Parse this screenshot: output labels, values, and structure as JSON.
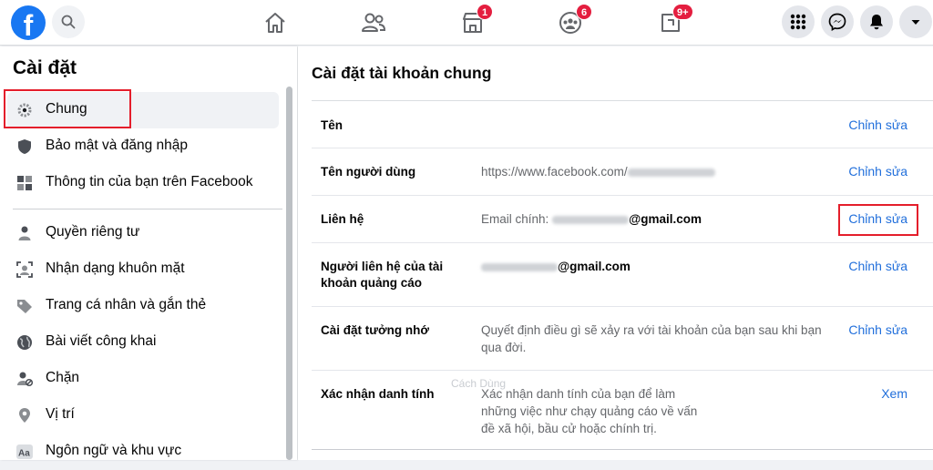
{
  "topbar": {
    "logo_letter": "f",
    "badges": {
      "marketplace": "1",
      "groups": "6",
      "gaming": "9+"
    },
    "icons": {
      "search": "search-icon",
      "home": "home-icon",
      "friends": "friends-icon",
      "marketplace": "marketplace-icon",
      "groups": "groups-icon",
      "gaming": "gaming-icon",
      "menu": "grid-menu-icon",
      "messenger": "messenger-icon",
      "notifications": "bell-icon",
      "account": "caret-down-icon"
    },
    "colors": {
      "brand": "#1877f2",
      "badge": "#e41e3f"
    }
  },
  "sidebar": {
    "title": "Cài đặt",
    "items": [
      {
        "label": "Chung",
        "icon": "gear-icon",
        "active": true
      },
      {
        "label": "Bảo mật và đăng nhập",
        "icon": "shield-icon"
      },
      {
        "label": "Thông tin của bạn trên Facebook",
        "icon": "facebook-info-icon"
      },
      {
        "label": "Quyền riêng tư",
        "icon": "lock-person-icon"
      },
      {
        "label": "Nhận dạng khuôn mặt",
        "icon": "face-recognition-icon"
      },
      {
        "label": "Trang cá nhân và gắn thẻ",
        "icon": "tag-icon"
      },
      {
        "label": "Bài viết công khai",
        "icon": "globe-icon"
      },
      {
        "label": "Chặn",
        "icon": "block-user-icon"
      },
      {
        "label": "Vị trí",
        "icon": "location-pin-icon"
      },
      {
        "label": "Ngôn ngữ và khu vực",
        "icon": "language-icon"
      }
    ]
  },
  "main": {
    "title": "Cài đặt tài khoản chung",
    "rows": [
      {
        "label": "Tên",
        "value": "",
        "action": "Chỉnh sửa"
      },
      {
        "label": "Tên người dùng",
        "value": "https://www.facebook.com/",
        "action": "Chỉnh sửa"
      },
      {
        "label": "Liên hệ",
        "value_prefix": "Email chính:",
        "value_bold": "@gmail.com",
        "action": "Chỉnh sửa"
      },
      {
        "label": "Người liên hệ của tài khoản quảng cáo",
        "value_bold": "@gmail.com",
        "action": "Chỉnh sửa"
      },
      {
        "label": "Cài đặt tưởng nhớ",
        "value": "Quyết định điều gì sẽ xảy ra với tài khoản của bạn sau khi bạn qua đời.",
        "action": "Chỉnh sửa"
      },
      {
        "label": "Xác nhận danh tính",
        "value": "Xác nhận danh tính của bạn để làm những việc như chạy quảng cáo về vấn đề xã hội, bầu cử hoặc chính trị.",
        "action": "Xem"
      }
    ],
    "watermark": "Cách Dùng"
  },
  "colors": {
    "link": "#216fdb",
    "highlight_box": "#e41e2b"
  }
}
